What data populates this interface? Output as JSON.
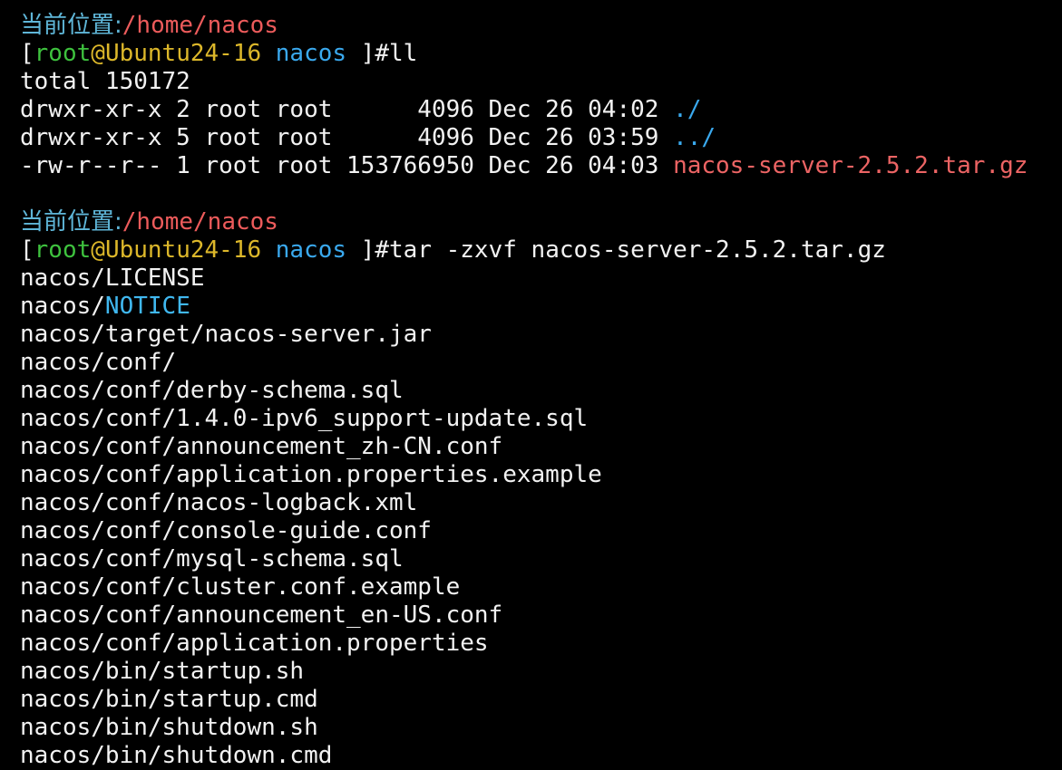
{
  "colors": {
    "background": "#000000",
    "default_text": "#f2f2f2",
    "location_label": "#5fb6d8",
    "location_path": "#ec5b5b",
    "prompt_user": "#3ec23e",
    "prompt_host": "#dcb72a",
    "prompt_dir": "#3aa9ee",
    "archive_file": "#ec6464",
    "notice_file": "#40b8f0"
  },
  "block1": {
    "location_label": "当前位置:",
    "location_path": "/home/nacos",
    "prompt": {
      "open": "[",
      "user": "root",
      "at": "@",
      "host": "Ubuntu24-16",
      "dir": " nacos ",
      "close": "]#",
      "command": "ll"
    },
    "total": "total 150172",
    "listing": [
      {
        "prefix": "drwxr-xr-x 2 root root      4096 Dec 26 04:02 ",
        "name": "./"
      },
      {
        "prefix": "drwxr-xr-x 5 root root      4096 Dec 26 03:59 ",
        "name": "../"
      },
      {
        "prefix": "-rw-r--r-- 1 root root 153766950 Dec 26 04:03 ",
        "name": "nacos-server-2.5.2.tar.gz"
      }
    ]
  },
  "block2": {
    "location_label": "当前位置:",
    "location_path": "/home/nacos",
    "prompt": {
      "open": "[",
      "user": "root",
      "at": "@",
      "host": "Ubuntu24-16",
      "dir": " nacos ",
      "close": "]#",
      "command": "tar -zxvf nacos-server-2.5.2.tar.gz"
    },
    "output": {
      "line1": "nacos/LICENSE",
      "line2_prefix": "nacos/",
      "line2_name": "NOTICE",
      "rest": [
        "nacos/target/nacos-server.jar",
        "nacos/conf/",
        "nacos/conf/derby-schema.sql",
        "nacos/conf/1.4.0-ipv6_support-update.sql",
        "nacos/conf/announcement_zh-CN.conf",
        "nacos/conf/application.properties.example",
        "nacos/conf/nacos-logback.xml",
        "nacos/conf/console-guide.conf",
        "nacos/conf/mysql-schema.sql",
        "nacos/conf/cluster.conf.example",
        "nacos/conf/announcement_en-US.conf",
        "nacos/conf/application.properties",
        "nacos/bin/startup.sh",
        "nacos/bin/startup.cmd",
        "nacos/bin/shutdown.sh",
        "nacos/bin/shutdown.cmd"
      ]
    }
  }
}
